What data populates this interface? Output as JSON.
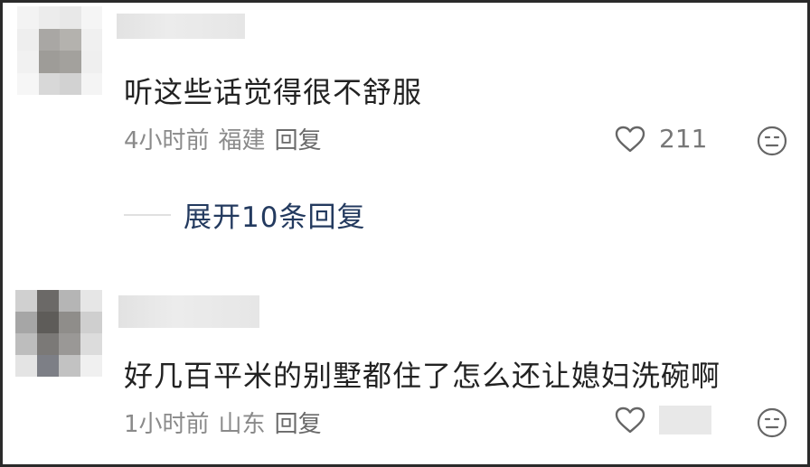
{
  "comments": [
    {
      "text": "听这些话觉得很不舒服",
      "time": "4小时前",
      "location": "福建",
      "reply_label": "回复",
      "likes": "211",
      "like_icon": "heart-outline-icon",
      "reaction_icon": "unhappy-face-icon",
      "expand_replies": "展开10条回复"
    },
    {
      "text": "好几百平米的别墅都住了怎么还让媳妇洗碗啊",
      "time": "1小时前",
      "location": "山东",
      "reply_label": "回复",
      "like_icon": "heart-outline-icon",
      "reaction_icon": "unhappy-face-icon"
    }
  ],
  "colors": {
    "text": "#222222",
    "meta": "#8a8a8a",
    "expand": "#233a5f",
    "icon": "#666666"
  }
}
